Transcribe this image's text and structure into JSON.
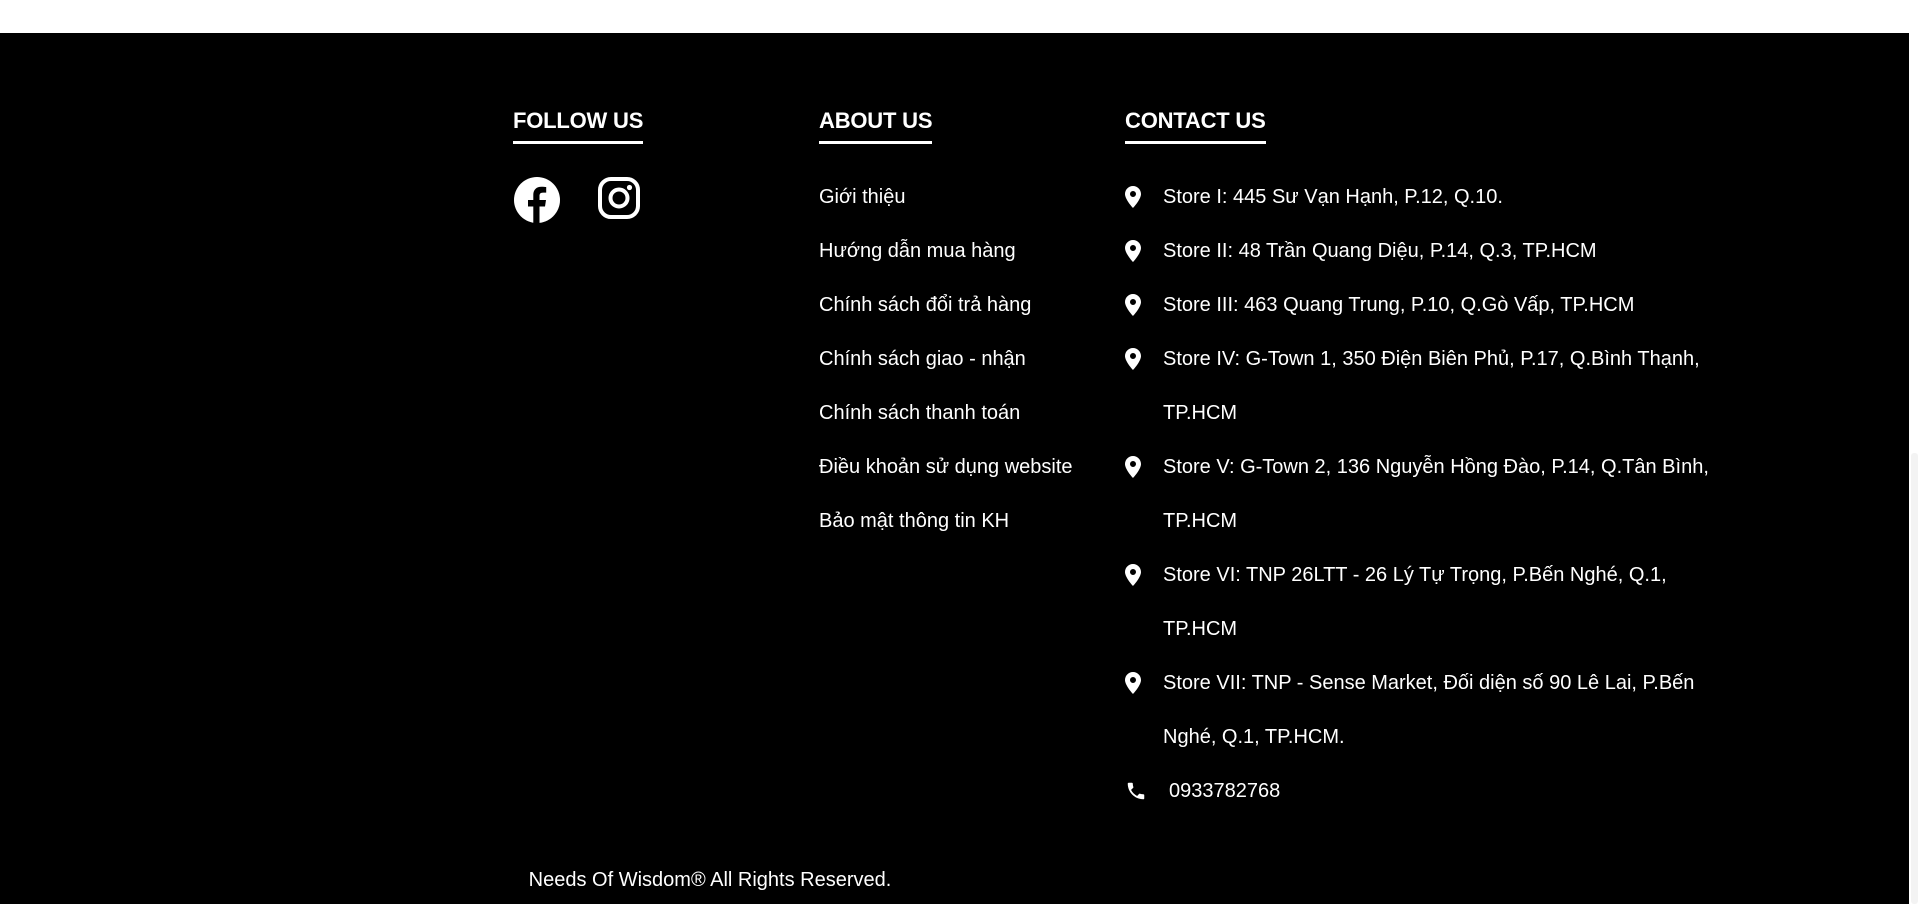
{
  "follow": {
    "heading": "FOLLOW US",
    "icons": [
      "facebook-icon",
      "instagram-icon"
    ]
  },
  "about": {
    "heading": "ABOUT US",
    "links": [
      "Giới thiệu",
      "Hướng dẫn mua hàng",
      "Chính sách đổi trả hàng",
      "Chính sách giao - nhận",
      "Chính sách thanh toán",
      "Điều khoản sử dụng website",
      "Bảo mật thông tin KH"
    ]
  },
  "contact": {
    "heading": "CONTACT US",
    "stores": [
      "Store I: 445 Sư Vạn Hạnh, P.12, Q.10.",
      "Store II: 48 Trần Quang Diệu, P.14, Q.3, TP.HCM",
      "Store III: 463 Quang Trung, P.10, Q.Gò Vấp, TP.HCM",
      "Store IV: G-Town 1, 350 Điện Biên Phủ, P.17, Q.Bình Thạnh, TP.HCM",
      "Store V: G-Town 2, 136 Nguyễn Hồng Đào, P.14, Q.Tân Bình, TP.HCM",
      "Store VI: TNP 26LTT - 26 Lý Tự Trọng, P.Bến Nghé, Q.1, TP.HCM",
      "Store VII: TNP - Sense Market, Đối diện số 90 Lê Lai, P.Bến Nghé, Q.1, TP.HCM."
    ],
    "phone": "0933782768"
  },
  "copyright": "Needs Of Wisdom® All Rights Reserved.",
  "colors": {
    "background": "#000000",
    "text": "#ffffff"
  }
}
